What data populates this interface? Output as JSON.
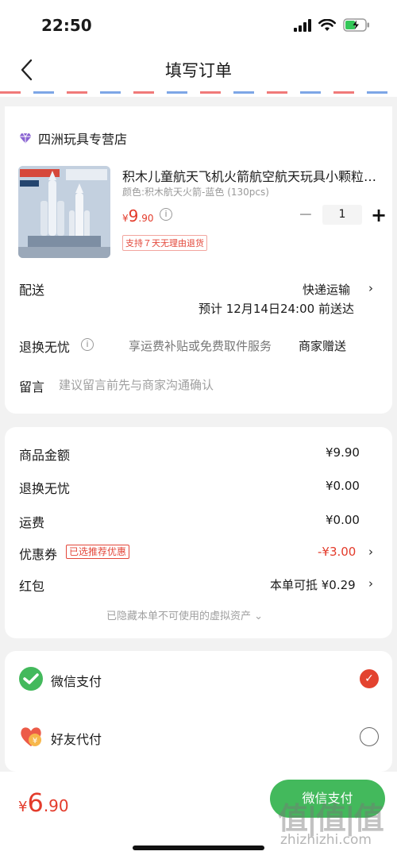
{
  "status_bar": {
    "time": "22:50"
  },
  "nav": {
    "title": "填写订单"
  },
  "store": {
    "name": "四洲玩具专营店"
  },
  "product": {
    "title": "积木儿童航天飞机火箭航空航天玩具小颗粒拼装模型",
    "variant": "颜色:积木航天火箭-蓝色 (130pcs)",
    "price_currency": "¥",
    "price_int": "9",
    "price_dec": ".90",
    "info_icon": "i",
    "quantity": "1",
    "minus": "−",
    "plus": "+",
    "return_badge": "支持７天无理由退货",
    "image_text_top": "积木航天火箭",
    "image_text_count": "130pcs"
  },
  "delivery": {
    "label": "配送",
    "method": "快递运输",
    "eta": "预计 12月14日24:00 前送达"
  },
  "worry_free": {
    "label": "退换无忧",
    "info_icon": "i",
    "desc": "享运费补贴或免费取件服务",
    "value": "商家赠送"
  },
  "message": {
    "label": "留言",
    "placeholder": "建议留言前先与商家沟通确认"
  },
  "price_summary": {
    "goods_label": "商品金额",
    "goods_value": "¥9.90",
    "worry_label": "退换无忧",
    "worry_value": "¥0.00",
    "shipping_label": "运费",
    "shipping_value": "¥0.00",
    "coupon_label": "优惠券",
    "coupon_tag": "已选推荐优惠",
    "coupon_value": "-¥3.00",
    "redpacket_label": "红包",
    "redpacket_value": "本单可抵 ¥0.29",
    "hidden_note": "已隐藏本单不可使用的虚拟资产 ⌄"
  },
  "payment": {
    "wechat_label": "微信支付",
    "friend_label": "好友代付",
    "friend_icon_text": "¥",
    "check_mark": "✓"
  },
  "bottom": {
    "total_currency": "¥",
    "total_int": "6",
    "total_dec": ".90",
    "pay_button": "微信支付",
    "watermark_logo": "值|值|值",
    "watermark_url": "zhizhizhi.com"
  },
  "colors": {
    "accent_red": "#e33b2b",
    "wechat_green": "#43b95c"
  }
}
